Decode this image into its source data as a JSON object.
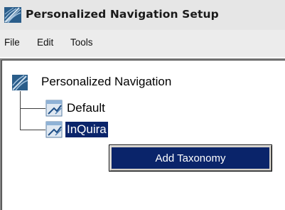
{
  "window": {
    "title": "Personalized Navigation Setup",
    "icon": "app-logo-icon"
  },
  "menubar": {
    "items": [
      {
        "label": "File"
      },
      {
        "label": "Edit"
      },
      {
        "label": "Tools"
      }
    ]
  },
  "tree": {
    "root": {
      "label": "Personalized Navigation",
      "icon": "app-logo-icon"
    },
    "children": [
      {
        "label": "Default",
        "icon": "taxonomy-node-icon",
        "selected": false
      },
      {
        "label": "InQuira",
        "icon": "taxonomy-node-icon",
        "selected": true
      }
    ]
  },
  "context_menu": {
    "items": [
      {
        "label": "Add Taxonomy",
        "highlighted": true
      }
    ]
  },
  "colors": {
    "selection": "#0a246a",
    "menu_bg": "#d4d0c8"
  }
}
